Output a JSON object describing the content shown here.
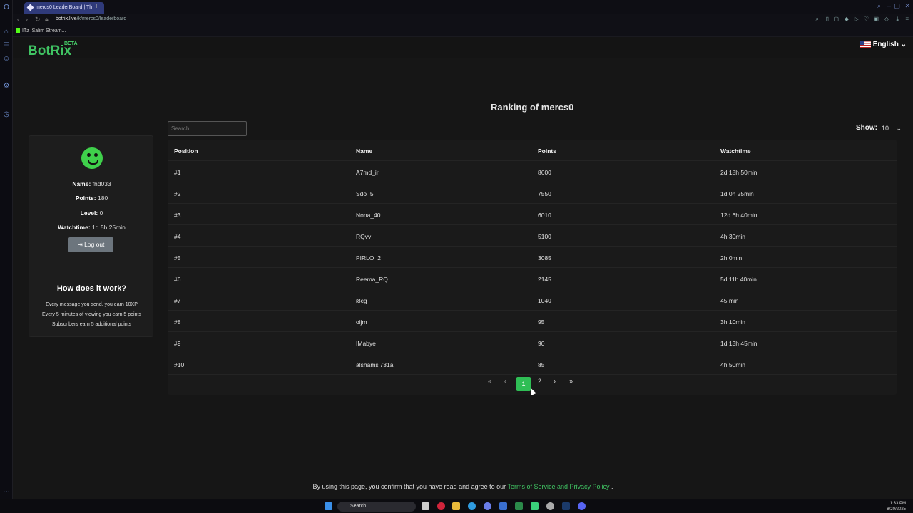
{
  "browser": {
    "tab_title": "mercs0 LeaderBoard | Th",
    "url_domain": "botrix.live",
    "url_path": "/k/mercs0/leaderboard",
    "bookmark": "ITz_Salim Stream..."
  },
  "header": {
    "logo": "BotRix",
    "badge": "BETA",
    "language": "English"
  },
  "page_title": "Ranking of mercs0",
  "profile": {
    "name_label": "Name:",
    "name": "fhd033",
    "points_label": "Points:",
    "points": "180",
    "level_label": "Level:",
    "level": "0",
    "watchtime_label": "Watchtime:",
    "watchtime": "1d 5h 25min",
    "logout_label": "Log out"
  },
  "how": {
    "title": "How does it work?",
    "lines": [
      "Every message you send, you earn 10XP",
      "Every 5 minutes of viewing you earn 5 points",
      "Subscribers earn 5 additional points"
    ]
  },
  "search": {
    "placeholder": "Search..."
  },
  "show": {
    "label": "Show:",
    "value": "10"
  },
  "table": {
    "headers": [
      "Position",
      "Name",
      "Points",
      "Watchtime"
    ],
    "rows": [
      [
        "#1",
        "A7md_ir",
        "8600",
        "2d 18h 50min"
      ],
      [
        "#2",
        "Sdo_5",
        "7550",
        "1d 0h 25min"
      ],
      [
        "#3",
        "Nona_40",
        "6010",
        "12d 6h 40min"
      ],
      [
        "#4",
        "RQvv",
        "5100",
        "4h 30min"
      ],
      [
        "#5",
        "PIRLO_2",
        "3085",
        "2h 0min"
      ],
      [
        "#6",
        "Reema_RQ",
        "2145",
        "5d 11h 40min"
      ],
      [
        "#7",
        "i8cg",
        "1040",
        "45 min"
      ],
      [
        "#8",
        "oijm",
        "95",
        "3h 10min"
      ],
      [
        "#9",
        "IMabye",
        "90",
        "1d 13h 45min"
      ],
      [
        "#10",
        "alshamsi731a",
        "85",
        "4h 50min"
      ]
    ]
  },
  "pagination": {
    "current": "1",
    "next": "2"
  },
  "footer": {
    "text": "By using this page, you confirm that you have read and agree to our",
    "link": "Terms of Service and Privacy Policy",
    "end": "."
  },
  "taskbar": {
    "search": "Search",
    "time": "1:33 PM",
    "date": "8/20/2025"
  },
  "colors": {
    "accent": "#40c463",
    "page_bg": "#161616"
  }
}
